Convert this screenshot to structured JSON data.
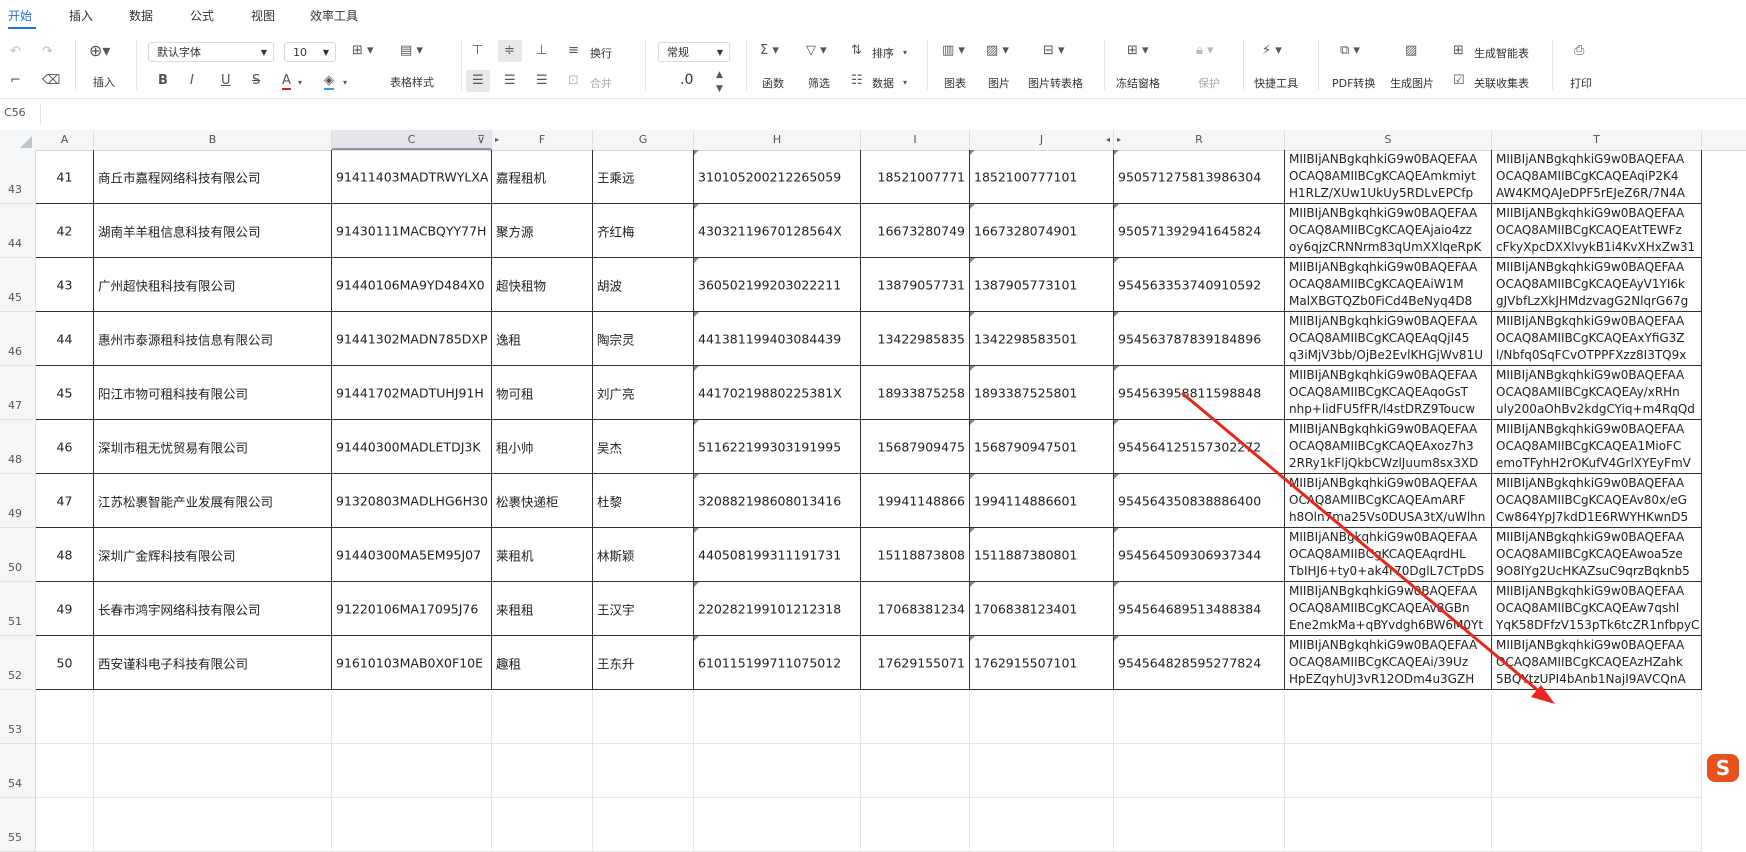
{
  "menu": [
    "开始",
    "插入",
    "数据",
    "公式",
    "视图",
    "效率工具"
  ],
  "ribbon": {
    "insert": "插入",
    "font": "默认字体",
    "size": "10",
    "table_style": "表格样式",
    "wrap": "换行",
    "merge": "合并",
    "number_format": "常规",
    "decimal": ".0",
    "function": "函数",
    "filter": "筛选",
    "sort": "排序",
    "data": "数据",
    "chart": "图表",
    "picture": "图片",
    "pic_to_table": "图片转表格",
    "freeze": "冻结窗格",
    "protect": "保护",
    "quick_tools": "快捷工具",
    "pdf": "PDF转换",
    "gen_image": "生成图片",
    "smart_table": "生成智能表",
    "linked_collect": "关联收集表",
    "print": "打印"
  },
  "name_box": "C56",
  "columns": [
    "A",
    "B",
    "C",
    "F",
    "G",
    "H",
    "I",
    "J",
    "R",
    "S",
    "T"
  ],
  "rows": [
    {
      "rn": "43",
      "a": "41",
      "b": "商丘市嘉程网络科技有限公司",
      "c": "91411403MADTRWYLXA",
      "f": "嘉程租机",
      "g": "王乘远",
      "h": "310105200212265059",
      "i": "18521007771",
      "j": "1852100777101",
      "r": "950571275813986304",
      "s": [
        "MIIBIjANBgkqhkiG9w0BAQEFAA",
        "OCAQ8AMIIBCgKCAQEAmkmiyt",
        "H1RLZ/XUw1UkUy5RDLvEPCfp"
      ],
      "t": [
        "MIIBIjANBgkqhkiG9w0BAQEFAA",
        "OCAQ8AMIIBCgKCAQEAqiP2K4",
        "AW4KMQAJeDPF5rEJeZ6R/7N4A"
      ]
    },
    {
      "rn": "44",
      "a": "42",
      "b": "湖南羊羊租信息科技有限公司",
      "c": "91430111MACBQYY77H",
      "f": "聚方源",
      "g": "齐红梅",
      "h": "43032119670128564X",
      "i": "16673280749",
      "j": "1667328074901",
      "r": "950571392941645824",
      "s": [
        "MIIBIjANBgkqhkiG9w0BAQEFAA",
        "OCAQ8AMIIBCgKCAQEAjaio4zz",
        "oy6qjzCRNNrm83qUmXXlqeRpK"
      ],
      "t": [
        "MIIBIjANBgkqhkiG9w0BAQEFAA",
        "OCAQ8AMIIBCgKCAQEAtTEWFz",
        "cFkyXpcDXXlvykB1i4KvXHxZw31"
      ]
    },
    {
      "rn": "45",
      "a": "43",
      "b": "广州超快租科技有限公司",
      "c": "91440106MA9YD484X0",
      "f": "超快租物",
      "g": "胡波",
      "h": "360502199203022211",
      "i": "13879057731",
      "j": "1387905773101",
      "r": "954563353740910592",
      "s": [
        "MIIBIjANBgkqhkiG9w0BAQEFAA",
        "OCAQ8AMIIBCgKCAQEAiW1M",
        "MalXBGTQZb0FiCd4BeNyq4D8"
      ],
      "t": [
        "MIIBIjANBgkqhkiG9w0BAQEFAA",
        "OCAQ8AMIIBCgKCAQEAyV1YI6k",
        "gJVbfLzXkJHMdzvagG2NlqrG67g"
      ]
    },
    {
      "rn": "46",
      "a": "44",
      "b": "惠州市泰源租科技信息有限公司",
      "c": "91441302MADN785DXP",
      "f": "逸租",
      "g": "陶宗灵",
      "h": "441381199403084439",
      "i": "13422985835",
      "j": "1342298583501",
      "r": "954563787839184896",
      "s": [
        "MIIBIjANBgkqhkiG9w0BAQEFAA",
        "OCAQ8AMIIBCgKCAQEAqQjI45",
        "q3iMjV3bb/OjBe2EvlKHGjWv81U"
      ],
      "t": [
        "MIIBIjANBgkqhkiG9w0BAQEFAA",
        "OCAQ8AMIIBCgKCAQEAxYfiG3Z",
        "l/Nbfq0SqFCvOTPPFXzz8I3TQ9x"
      ]
    },
    {
      "rn": "47",
      "a": "45",
      "b": "阳江市物可租科技有限公司",
      "c": "91441702MADTUHJ91H",
      "f": "物可租",
      "g": "刘广亮",
      "h": "44170219880225381X",
      "i": "18933875258",
      "j": "1893387525801",
      "r": "954563958811598848",
      "s": [
        "MIIBIjANBgkqhkiG9w0BAQEFAA",
        "OCAQ8AMIIBCgKCAQEAqoGsT",
        "nhp+lidFU5fFR/l4stDRZ9Toucw"
      ],
      "t": [
        "MIIBIjANBgkqhkiG9w0BAQEFAA",
        "OCAQ8AMIIBCgKCAQEAy/xRHn",
        "uly200aOhBv2kdgCYiq+m4RqQd"
      ]
    },
    {
      "rn": "48",
      "a": "46",
      "b": "深圳市租无忧贸易有限公司",
      "c": "91440300MADLETDJ3K",
      "f": "租小帅",
      "g": "吴杰",
      "h": "511622199303191995",
      "i": "15687909475",
      "j": "1568790947501",
      "r": "954564125157302272",
      "s": [
        "MIIBIjANBgkqhkiG9w0BAQEFAA",
        "OCAQ8AMIIBCgKCAQEAxoz7h3",
        "2RRy1kFljQkbCWzlJuum8sx3XD"
      ],
      "t": [
        "MIIBIjANBgkqhkiG9w0BAQEFAA",
        "OCAQ8AMIIBCgKCAQEA1MioFC",
        "emoTFyhH2rOKufV4GrlXYEyFmV"
      ]
    },
    {
      "rn": "49",
      "a": "47",
      "b": "江苏松裹智能产业发展有限公司",
      "c": "91320803MADLHG6H30",
      "f": "松裹快递柜",
      "g": "杜黎",
      "h": "320882198608013416",
      "i": "19941148866",
      "j": "1994114886601",
      "r": "954564350838886400",
      "s": [
        "MIIBIjANBgkqhkiG9w0BAQEFAA",
        "OCAQ8AMIIBCgKCAQEAmARF",
        "h8Oln7ma25Vs0DUSA3tX/uWlhn"
      ],
      "t": [
        "MIIBIjANBgkqhkiG9w0BAQEFAA",
        "OCAQ8AMIIBCgKCAQEAv80x/eG",
        "Cw864YpJ7kdD1E6RWYHKwnD5"
      ]
    },
    {
      "rn": "50",
      "a": "48",
      "b": "深圳广金辉科技有限公司",
      "c": "91440300MA5EM95J07",
      "f": "莱租机",
      "g": "林斯颖",
      "h": "440508199311191731",
      "i": "15118873808",
      "j": "1511887380801",
      "r": "954564509306937344",
      "s": [
        "MIIBIjANBgkqhkiG9w0BAQEFAA",
        "OCAQ8AMIIBCgKCAQEAqrdHL",
        "TbIHJ6+ty0+ak4r70DglL7CTpDS"
      ],
      "t": [
        "MIIBIjANBgkqhkiG9w0BAQEFAA",
        "OCAQ8AMIIBCgKCAQEAwoa5ze",
        "9O8IYg2UcHKAZsuC9qrzBqknb5"
      ]
    },
    {
      "rn": "51",
      "a": "49",
      "b": "长春市鸿宇网络科技有限公司",
      "c": "91220106MA17095J76",
      "f": "来租租",
      "g": "王汉宇",
      "h": "220282199101212318",
      "i": "17068381234",
      "j": "1706838123401",
      "r": "954564689513488384",
      "s": [
        "MIIBIjANBgkqhkiG9w0BAQEFAA",
        "OCAQ8AMIIBCgKCAQEAv8GBn",
        "Ene2mkMa+qBYvdgh6BW6M0Yt"
      ],
      "t": [
        "MIIBIjANBgkqhkiG9w0BAQEFAA",
        "OCAQ8AMIIBCgKCAQEAw7qshl",
        "YqK58DFfzV153pTk6tcZR1nfbpyC"
      ]
    },
    {
      "rn": "52",
      "a": "50",
      "b": "西安谨科电子科技有限公司",
      "c": "91610103MAB0X0F10E",
      "f": "趣租",
      "g": "王东升",
      "h": "610115199711075012",
      "i": "17629155071",
      "j": "1762915507101",
      "r": "954564828595277824",
      "s": [
        "MIIBIjANBgkqhkiG9w0BAQEFAA",
        "OCAQ8AMIIBCgKCAQEAi/39Uz",
        "HpEZqyhUJ3vR12ODm4u3GZH"
      ],
      "t": [
        "MIIBIjANBgkqhkiG9w0BAQEFAA",
        "OCAQ8AMIIBCgKCAQEAzHZahk",
        "5BQYtzUPI4bAnb1NajI9AVCQnA"
      ]
    }
  ],
  "empty_rows": [
    "53",
    "54",
    "55"
  ],
  "logo_letter": "S",
  "colors": {
    "accent": "#1f6fe5",
    "annotation": "#e8281e",
    "logo": "#e8501c"
  }
}
